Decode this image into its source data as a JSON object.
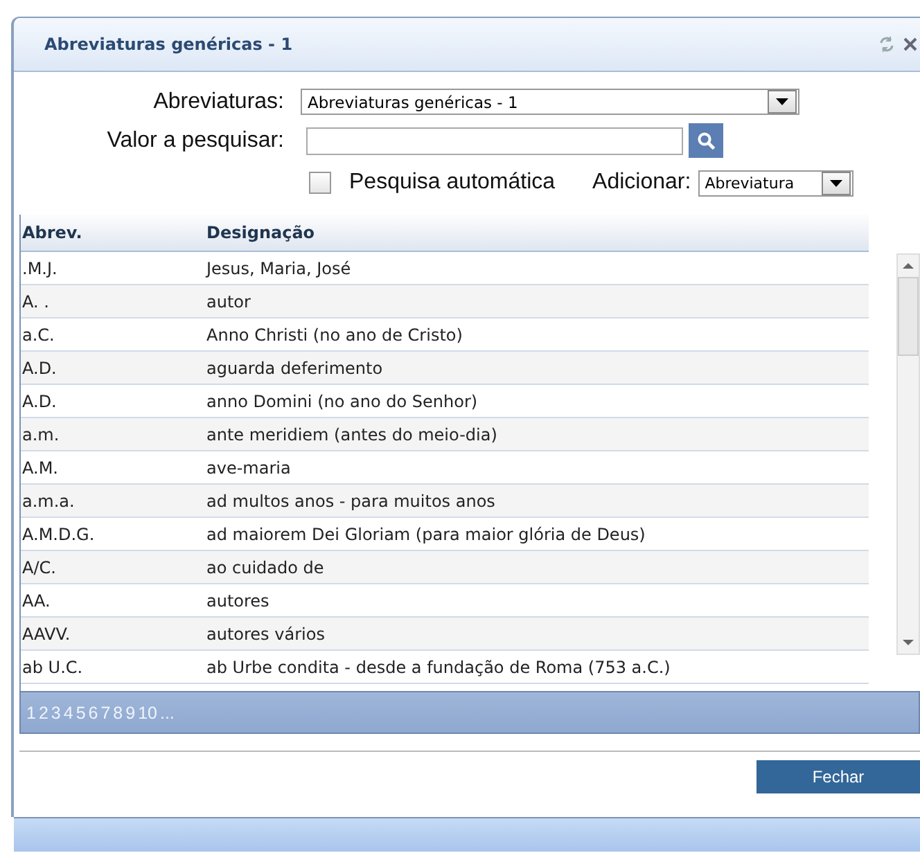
{
  "window": {
    "title": "Abreviaturas genéricas - 1"
  },
  "form": {
    "list_label": "Abreviaturas:",
    "list_value": "Abreviaturas genéricas - 1",
    "search_label": "Valor a pesquisar:",
    "auto_search": {
      "label": "Pesquisa automática",
      "checked": false
    },
    "add_label": "Adicionar:",
    "add_value": "Abreviatura"
  },
  "table": {
    "columns": [
      "Abrev.",
      "Designação"
    ],
    "rows": [
      [
        ".M.J.",
        "Jesus, Maria, José"
      ],
      [
        "A. .",
        "autor"
      ],
      [
        "a.C.",
        "Anno Christi (no ano de Cristo)"
      ],
      [
        "A.D.",
        "aguarda deferimento"
      ],
      [
        "A.D.",
        "anno Domini (no ano do Senhor)"
      ],
      [
        "a.m.",
        "ante meridiem (antes do meio-dia)"
      ],
      [
        "A.M.",
        "ave-maria"
      ],
      [
        "a.m.a.",
        "ad multos anos - para muitos anos"
      ],
      [
        "A.M.D.G.",
        "ad maiorem Dei Gloriam (para maior glória de Deus)"
      ],
      [
        "A/C.",
        "ao cuidado de"
      ],
      [
        "AA.",
        "autores"
      ],
      [
        "AAVV.",
        "autores vários"
      ],
      [
        "ab U.C.",
        "ab Urbe condita - desde a fundação de Roma (753 a.C.)"
      ]
    ]
  },
  "pager": [
    "1",
    "2",
    "3",
    "4",
    "5",
    "6",
    "7",
    "8",
    "9",
    "10",
    "..."
  ],
  "buttons": [
    "Fechar"
  ]
}
